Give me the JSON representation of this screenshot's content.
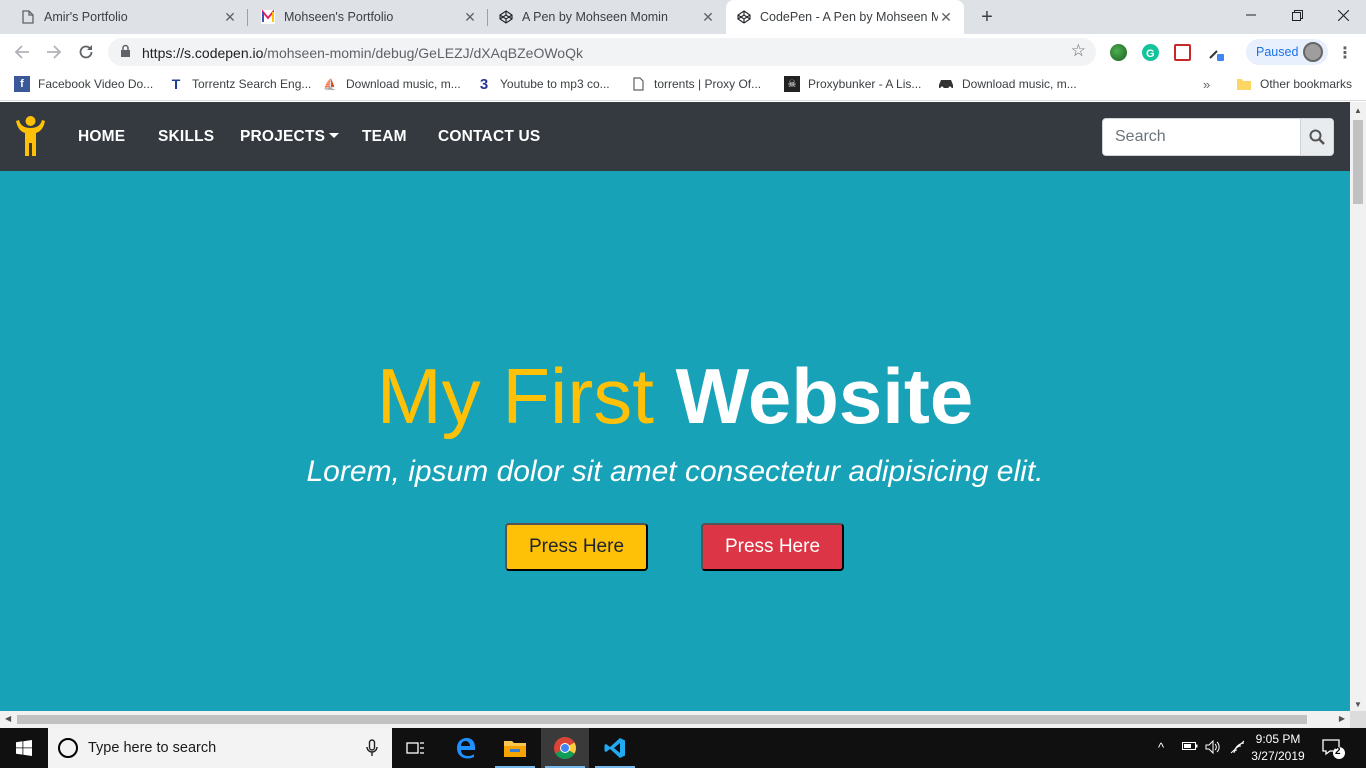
{
  "browser": {
    "tabs": [
      {
        "title": "Amir's Portfolio",
        "active": false
      },
      {
        "title": "Mohseen's Portfolio",
        "active": false
      },
      {
        "title": "A Pen by Mohseen Momin",
        "active": false
      },
      {
        "title": "CodePen - A Pen by Mohseen Mo",
        "active": true
      }
    ],
    "url_host": "https://s.codepen.io",
    "url_path": "/mohseen-momin/debug/GeLEZJ/dXAqBZeOWoQk",
    "profile_status": "Paused",
    "bookmarks": [
      {
        "label": "Facebook Video Do...",
        "icon": "facebook-icon"
      },
      {
        "label": "Torrentz Search Eng...",
        "icon": "torrentz-icon"
      },
      {
        "label": "Download music, m...",
        "icon": "ship-icon"
      },
      {
        "label": "Youtube to mp3 co...",
        "icon": "number-3-icon"
      },
      {
        "label": "torrents | Proxy Of...",
        "icon": "page-icon"
      },
      {
        "label": "Proxybunker - A Lis...",
        "icon": "pirate-icon"
      },
      {
        "label": "Download music, m...",
        "icon": "car-icon"
      }
    ],
    "bookmarks_more": "»",
    "other_bookmarks": "Other bookmarks"
  },
  "site": {
    "nav": {
      "items": [
        {
          "label": "HOME"
        },
        {
          "label": "SKILLS"
        },
        {
          "label": "PROJECTS",
          "dropdown": true
        },
        {
          "label": "TEAM"
        },
        {
          "label": "CONTACT US"
        }
      ],
      "search_placeholder": "Search"
    },
    "hero": {
      "title_light": "My First",
      "title_bold": "Website",
      "subtitle": "Lorem, ipsum dolor sit amet consectetur adipisicing elit.",
      "button_primary": "Press Here",
      "button_secondary": "Press Here"
    },
    "colors": {
      "navbar": "#343a40",
      "hero_bg": "#17a2b8",
      "accent_yellow": "#ffc107",
      "accent_red": "#dc3545"
    }
  },
  "taskbar": {
    "search_placeholder": "Type here to search",
    "time": "9:05 PM",
    "date": "3/27/2019",
    "notification_count": "2"
  }
}
